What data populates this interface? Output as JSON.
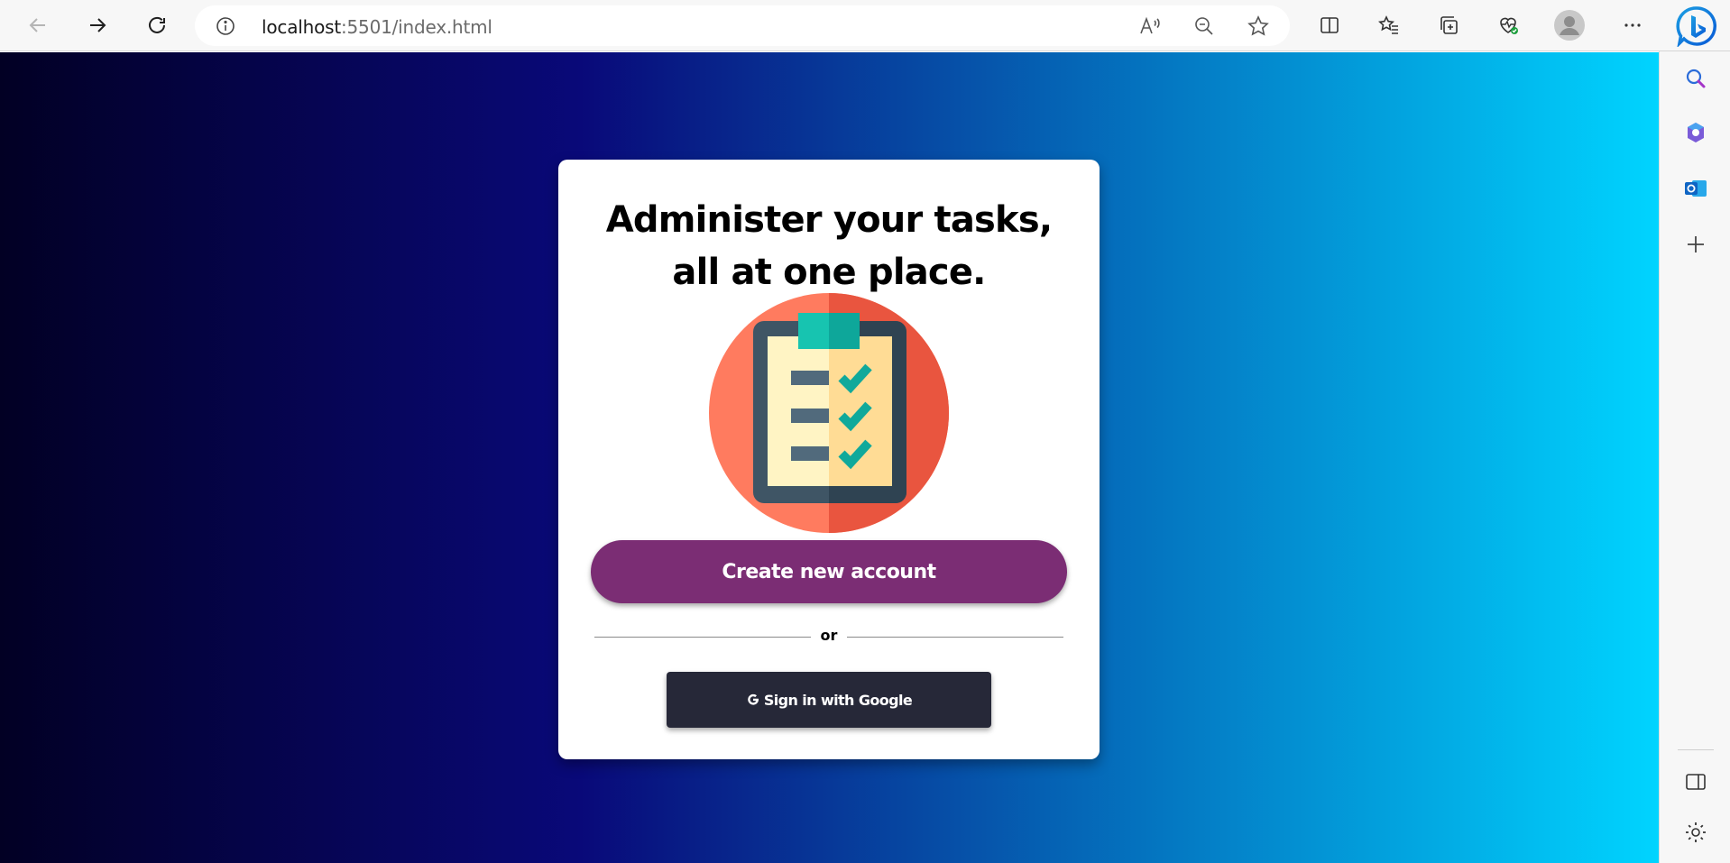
{
  "browser": {
    "url_host": "localhost",
    "url_rest": ":5501/index.html",
    "icons": [
      "back-icon",
      "forward-icon",
      "refresh-icon",
      "site-info-icon",
      "read-aloud-icon",
      "zoom-out-icon",
      "favorite-star-icon",
      "split-screen-icon",
      "favorites-icon",
      "collections-icon",
      "browser-essentials-icon",
      "profile-icon",
      "more-icon",
      "bing-copilot-icon"
    ]
  },
  "sidebar": {
    "icons": [
      "search-icon",
      "copilot-icon",
      "outlook-icon",
      "add-icon",
      "sidebar-toggle-icon",
      "settings-icon"
    ]
  },
  "page": {
    "title": "Administer your tasks, all at one place.",
    "illustration": "clipboard-checklist-icon",
    "create_account_label": "Create new account",
    "divider_text": "or",
    "google_signin_label": "Sign in with Google"
  },
  "colors": {
    "gradient_start": "#020024",
    "gradient_mid": "#090979",
    "gradient_end": "#00d4ff",
    "create_button": "#7b2d74",
    "google_button": "#262838"
  }
}
